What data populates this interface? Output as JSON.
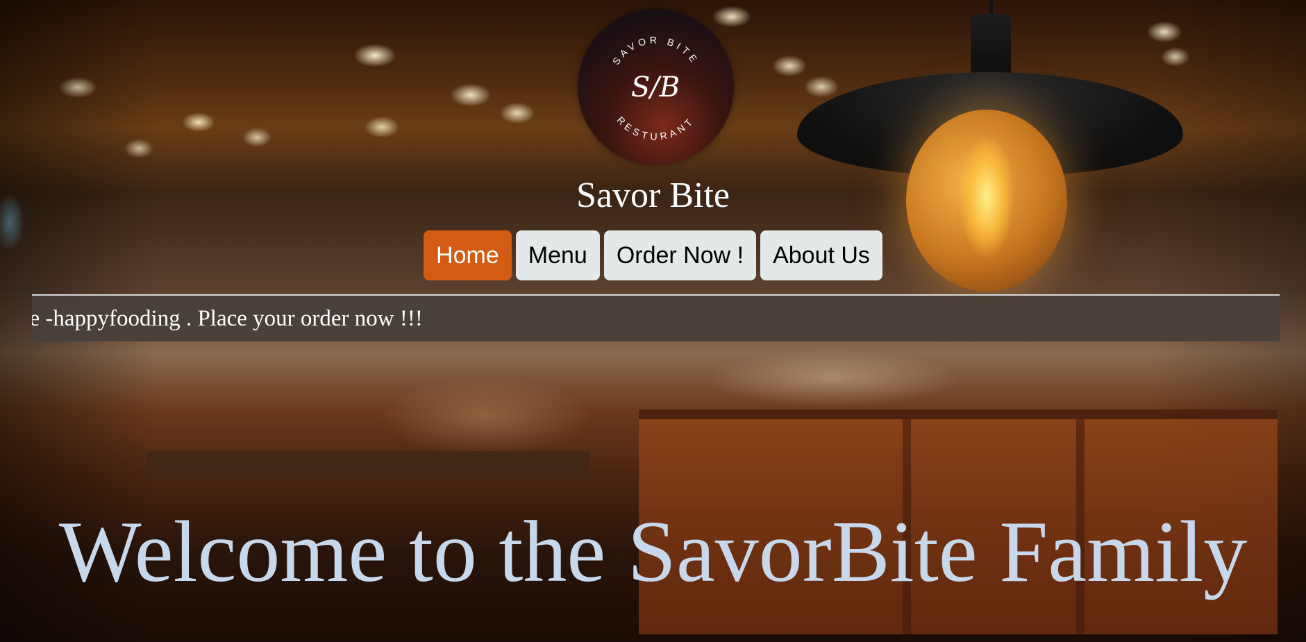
{
  "brand": {
    "logo_alt": "Savor Bite Resturant logo",
    "logo_top_text": "SAVOR BITE",
    "logo_monogram": "S/B",
    "logo_bottom_text": "RESTURANT",
    "site_title": "Savor Bite"
  },
  "nav": {
    "items": [
      {
        "label": "Home",
        "active": true
      },
      {
        "label": "Menu",
        "active": false
      },
      {
        "label": "Order Now !",
        "active": false
      },
      {
        "label": "About Us",
        "active": false
      }
    ]
  },
  "marquee": {
    "text": "de -happyfooding . Place your order now !!!"
  },
  "hero": {
    "heading": "Welcome to the SavorBite Family"
  },
  "colors": {
    "nav_active": "#d35b14",
    "nav_default": "#e3e8e8",
    "marquee_bg": "#48403a",
    "heading": "#c8d8ec"
  }
}
